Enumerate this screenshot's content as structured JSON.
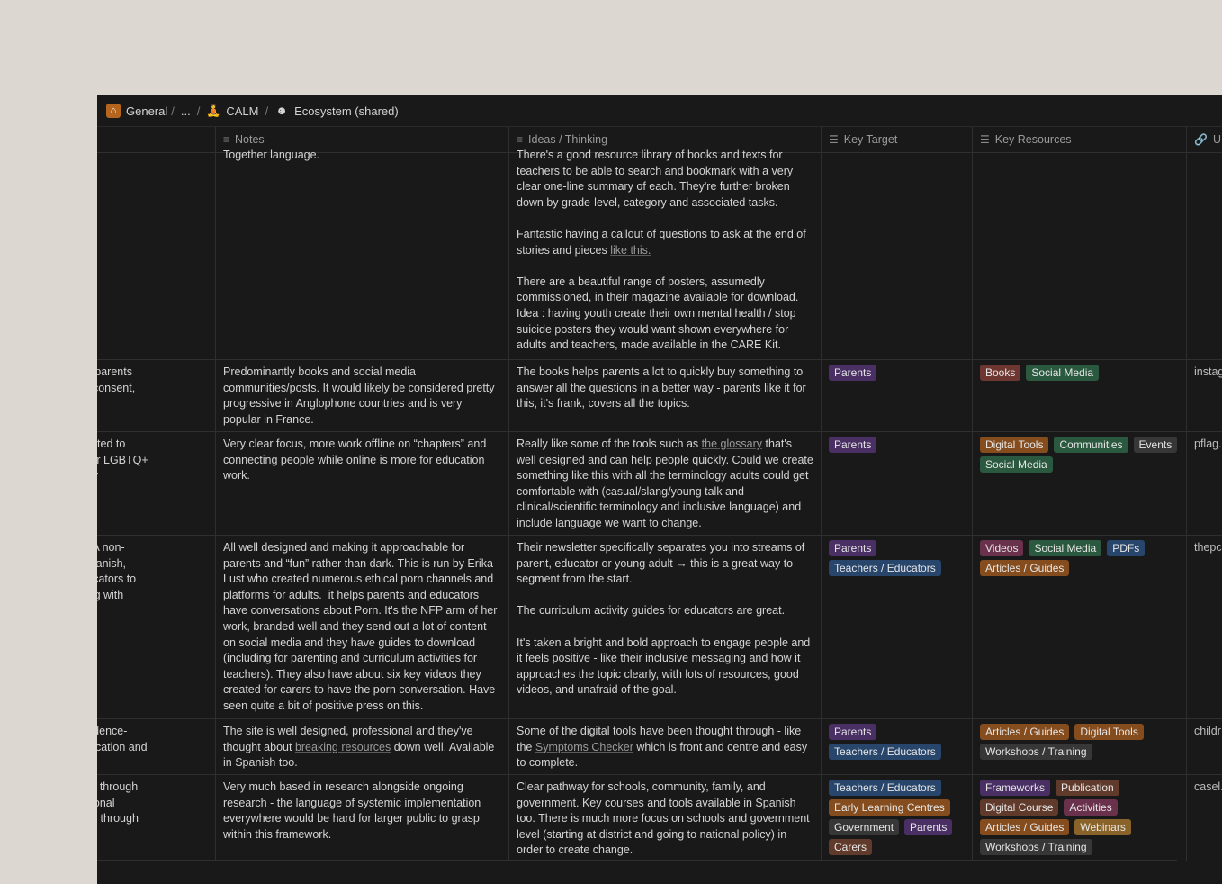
{
  "breadcrumb": {
    "general": "General",
    "ellipsis": "...",
    "calm": "CALM",
    "ecosystem": "Ecosystem (shared)"
  },
  "columns": {
    "notes": "Notes",
    "ideas": "Ideas / Thinking",
    "target": "Key Target",
    "resources": "Key Resources",
    "url": "UR"
  },
  "colors": {
    "purple": "#492f64",
    "blue": "#28456c",
    "brown": "#603b2c",
    "green": "#2b593f",
    "orange": "#854c1d",
    "gray": "#373737",
    "yellow": "#89632a",
    "pink": "#69314c",
    "red": "#6e3630"
  },
  "rows": [
    {
      "desc": "",
      "notes": "Together language.",
      "ideas_1": "There's a good resource library of books and texts for teachers to be able to search and bookmark with a very clear one-line summary of each. They're further broken down by grade-level, category and associated tasks.",
      "ideas_2a": "Fantastic having a callout of questions to ask at the end of stories and pieces ",
      "ideas_2link": "like this.",
      "ideas_3": "There are a beautiful range of posters, assumedly commissioned, in their magazine available for download. Idea : having youth create their own mental health / stop suicide posters they would want shown everywhere for adults and teachers, made available in the CARE Kit.",
      "url": ""
    },
    {
      "desc": "rce aimed at parents\nty, changes, consent,\netc.",
      "notes": "Predominantly books and social media communities/posts. It would likely be considered pretty progressive in Anglophone countries and is very popular in France.",
      "ideas": "The books helps parents a lot to quickly buy something to answer all the questions in a better way - parents like it for this, it's frank, covers all the topics.",
      "targets": [
        "Parents"
      ],
      "resources": [
        "Books",
        "Social Media"
      ],
      "url": "instag"
    },
    {
      "desc": "he US dedicated to\nadvocating for LGBTQ+\nthem\" (mostly",
      "notes": "Very clear focus, more work offline on “chapters” and connecting people while online is more for education work.",
      "ideas_a": "Really like some of the tools such as ",
      "ideas_link": "the glossary",
      "ideas_b": " that's well designed and can help people quickly. Could we create something like this with all the terminology adults could get comfortable with (casual/slang/young talk and clinical/scientific terminology and inclusive language) and include language we want to change.",
      "targets": [
        "Parents"
      ],
      "resources": [
        "Digital Tools",
        "Communities",
        "Events",
        "Social Media"
      ],
      "url": "pflag."
    },
    {
      "desc": "s the slogal. A non-\nn English, Spanish,\nilies and educators to\nex - beginning with",
      "notes": "All well designed and making it approachable for parents and “fun” rather than dark. This is run by Erika Lust who created numerous ethical porn channels and platforms for adults.  it helps parents and educators have conversations about Porn. It's the NFP arm of her work, branded well and they send out a lot of content on social media and they have guides to download (including for parenting and curriculum activities for teachers). They also have about six key videos they created for carers to have the porn conversation. Have seen quite a bit of positive press on this.",
      "ideas_1": "Their newsletter specifically separates you into streams of parent, educator or young adult → this is a great way to segment from the start.",
      "ideas_2": "The curriculum activity guides for educators are great.",
      "ideas_3": "It's taken a bright and bold approach to engage people and it feels positive - like their inclusive messaging and how it approaches the topic clearly, with lots of resources, good videos, and unafraid of the goal.",
      "targets": [
        "Parents",
        "Teachers / Educators"
      ],
      "resources": [
        "Videos",
        "Social Media",
        "PDFs",
        "Articles / Guides"
      ],
      "url": "thepc"
    },
    {
      "desc": "al health, evidence-\ns : Care, Education and",
      "notes_a": "The site is well designed, professional and they've thought about ",
      "notes_link": "breaking resources",
      "notes_b": " down well. Available in Spanish too.",
      "ideas_a": "Some of the digital tools have been thought through - like the ",
      "ideas_link": "Symptoms Checker",
      "ideas_b": " which is front and centre and easy to complete.",
      "targets": [
        "Parents",
        "Teachers / Educators"
      ],
      "resources": [
        "Articles / Guides",
        "Digital Tools",
        "Workshops / Training"
      ],
      "url": "childr"
    },
    {
      "desc": "temic change through\nial and emotional\nom preschool through",
      "notes": "Very much based in research alongside ongoing research - the language of systemic implementation everywhere would be hard for larger public to grasp within this framework.",
      "ideas": "Clear pathway for schools, community, family, and government. Key courses and tools available in Spanish too. There is much more focus on schools and government level (starting at district and going to national policy) in order to create change.",
      "targets": [
        "Teachers / Educators",
        "Early Learning Centres",
        "Government",
        "Parents",
        "Carers"
      ],
      "resources": [
        "Frameworks",
        "Publication",
        "Digital Course",
        "Activities",
        "Articles / Guides",
        "Webinars",
        "Workshops / Training"
      ],
      "url": "casel."
    }
  ]
}
